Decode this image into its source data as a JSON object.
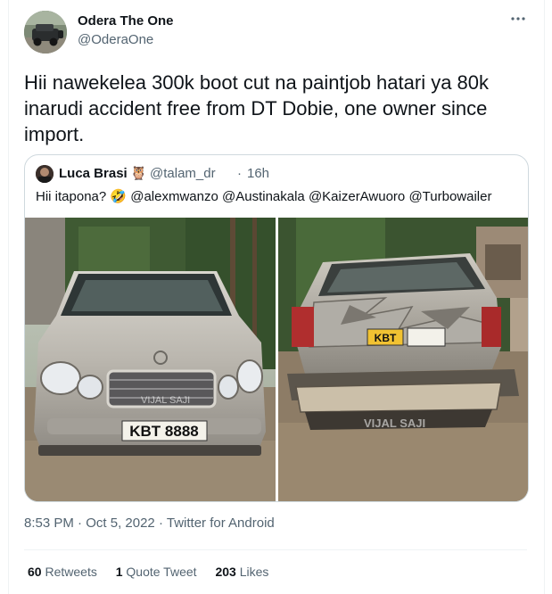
{
  "author": {
    "name": "Odera The One",
    "handle": "@OderaOne",
    "more_icon": "more-horizontal-icon"
  },
  "tweet": {
    "text": "Hii nawekelea 300k boot cut na paintjob hatari ya 80k inarudi accident free from DT Dobie, one owner since import."
  },
  "quoted_tweet": {
    "name": "Luca Brasi",
    "name_emoji": "🦉",
    "handle": "@talam_dr",
    "separator": "·",
    "time": "16h",
    "text": "Hii itapona? 🤣 @alexmwanzo @Austinakala @KaizerAwuoro @Turbowailer",
    "photo_left": {
      "plate": "KBT 8888",
      "watermark": "VIJAL SAJI"
    },
    "photo_right": {
      "plate": "KBT",
      "watermark": "VIJAL SAJI"
    }
  },
  "meta": {
    "time": "8:53 PM",
    "separator": "·",
    "date": "Oct 5, 2022",
    "source": "Twitter for Android"
  },
  "stats": {
    "retweets_count": "60",
    "retweets_label": "Retweets",
    "quotes_count": "1",
    "quotes_label": "Quote Tweet",
    "likes_count": "203",
    "likes_label": "Likes"
  }
}
